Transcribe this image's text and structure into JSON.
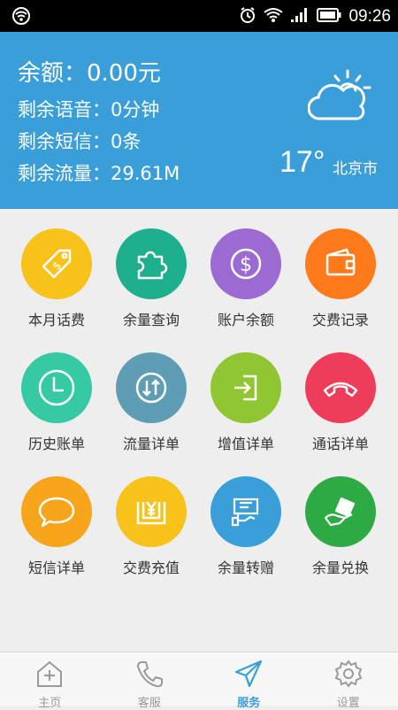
{
  "status_bar": {
    "time": "09:26",
    "icons": [
      "wifi-icon",
      "alarm-icon",
      "signal-icon",
      "battery-icon"
    ]
  },
  "header": {
    "balance": "余额：0.00元",
    "voice": "剩余语音：0分钟",
    "sms": "剩余短信：0条",
    "flow": "剩余流量：29.61M",
    "temperature": "17°",
    "city": "北京市",
    "weather_icon": "partly-cloudy-icon"
  },
  "grid": [
    {
      "label": "本月话费",
      "icon": "price-tag-icon",
      "color": "#f7c21a"
    },
    {
      "label": "余量查询",
      "icon": "puzzle-icon",
      "color": "#1eaf8c"
    },
    {
      "label": "账户余额",
      "icon": "dollar-icon",
      "color": "#9b6bd1"
    },
    {
      "label": "交费记录",
      "icon": "wallet-icon",
      "color": "#ff7a1a"
    },
    {
      "label": "历史账单",
      "icon": "clock-icon",
      "color": "#35c9a4"
    },
    {
      "label": "流量详单",
      "icon": "data-transfer-icon",
      "color": "#5f9db5"
    },
    {
      "label": "增值详单",
      "icon": "login-door-icon",
      "color": "#8fc631"
    },
    {
      "label": "通话详单",
      "icon": "phone-icon",
      "color": "#ee3d5a"
    },
    {
      "label": "短信详单",
      "icon": "message-bubble-icon",
      "color": "#f7a51a"
    },
    {
      "label": "交费充值",
      "icon": "yuan-payment-icon",
      "color": "#f7c21a"
    },
    {
      "label": "余量转赠",
      "icon": "gift-transfer-icon",
      "color": "#3a9fd9"
    },
    {
      "label": "余量兑换",
      "icon": "exchange-hand-icon",
      "color": "#2eaa45"
    }
  ],
  "bottom_nav": [
    {
      "label": "主页",
      "icon": "home-add-icon",
      "active": false
    },
    {
      "label": "客服",
      "icon": "phone-icon",
      "active": false
    },
    {
      "label": "服务",
      "icon": "send-icon",
      "active": true
    },
    {
      "label": "设置",
      "icon": "gear-icon",
      "active": false
    }
  ],
  "colors": {
    "header_bg": "#3a9fd9",
    "body_bg": "#eeeeee",
    "active_nav": "#3a9fd9"
  }
}
